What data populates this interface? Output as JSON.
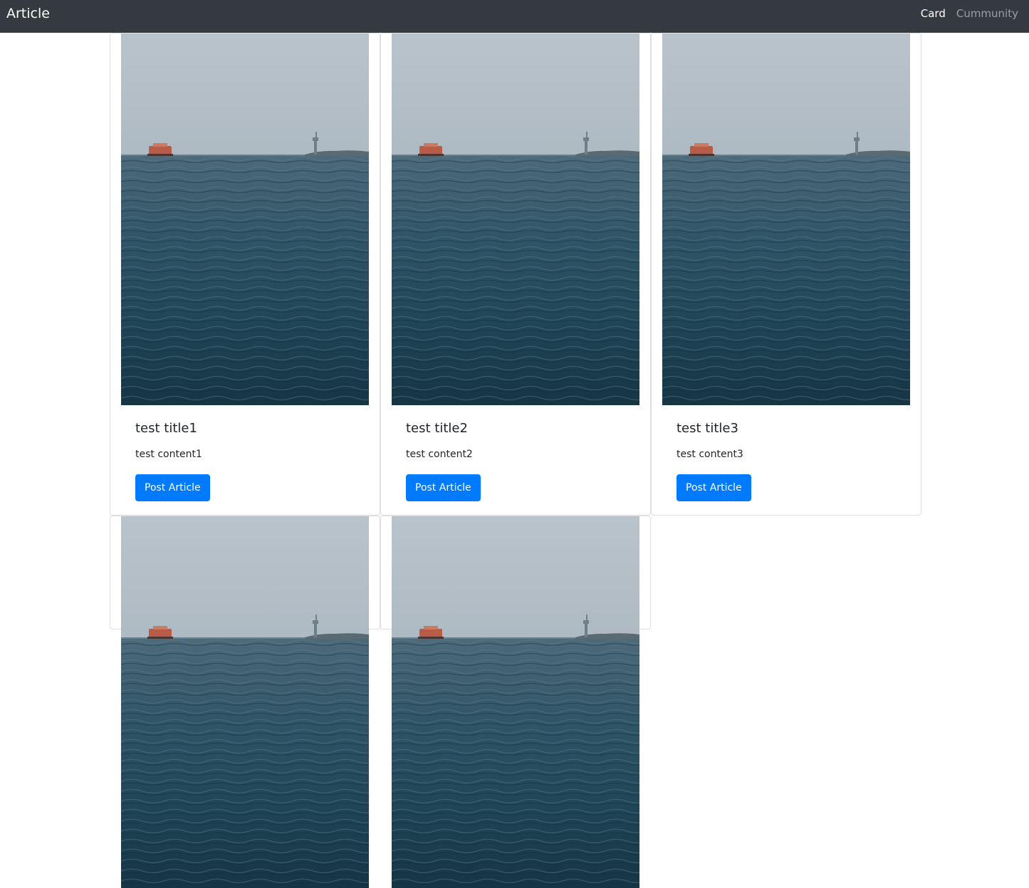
{
  "navbar": {
    "brand": "Article",
    "links": [
      {
        "label": "Card",
        "active": true
      },
      {
        "label": "Cummunity",
        "active": false
      }
    ],
    "background": "#343a40"
  },
  "cards": [
    {
      "title": "test title1",
      "content": "test content1",
      "button": "Post Article",
      "image": "sea-with-ship-and-statue-of-liberty"
    },
    {
      "title": "test title2",
      "content": "test content2",
      "button": "Post Article",
      "image": "sea-with-ship-and-statue-of-liberty"
    },
    {
      "title": "test title3",
      "content": "test content3",
      "button": "Post Article",
      "image": "sea-with-ship-and-statue-of-liberty"
    }
  ],
  "colors": {
    "primary_button": "#007bff",
    "card_border": "rgba(0,0,0,0.125)",
    "text": "#212529"
  }
}
